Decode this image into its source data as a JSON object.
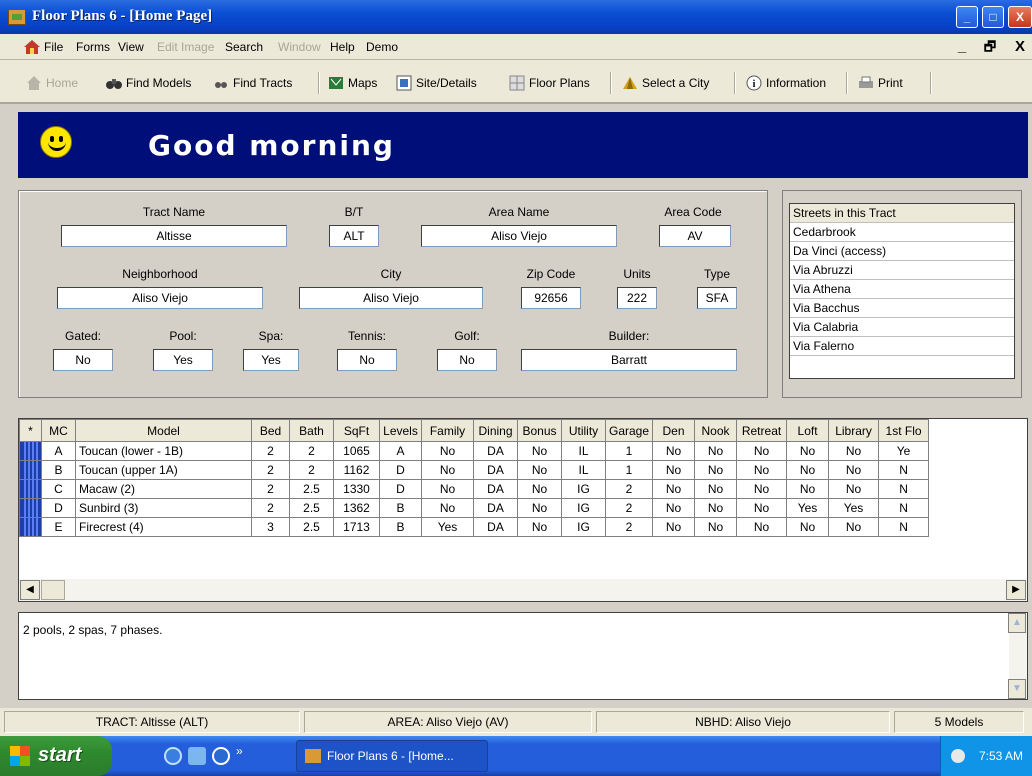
{
  "window": {
    "title": "Floor Plans 6 - [Home Page]",
    "min": "_",
    "max": "□",
    "close": "X"
  },
  "menu": {
    "items": [
      "File",
      "Forms",
      "View",
      "Edit Image",
      "Search",
      "Window",
      "Help",
      "Demo"
    ],
    "mdi_min": "_",
    "mdi_restore": "🗗",
    "mdi_close": "X"
  },
  "toolbar": {
    "items": [
      "Home",
      "Find Models",
      "Find Tracts",
      "Maps",
      "Site/Details",
      "Floor Plans",
      "Select a City",
      "Information",
      "Print"
    ]
  },
  "banner": {
    "greeting": "Good morning"
  },
  "tract": {
    "labels": {
      "tract_name": "Tract Name",
      "bt": "B/T",
      "area_name": "Area Name",
      "area_code": "Area Code",
      "neighborhood": "Neighborhood",
      "city": "City",
      "zip": "Zip Code",
      "units": "Units",
      "type": "Type",
      "gated": "Gated:",
      "pool": "Pool:",
      "spa": "Spa:",
      "tennis": "Tennis:",
      "golf": "Golf:",
      "builder": "Builder:"
    },
    "values": {
      "tract_name": "Altisse",
      "bt": "ALT",
      "area_name": "Aliso Viejo",
      "area_code": "AV",
      "neighborhood": "Aliso Viejo",
      "city": "Aliso Viejo",
      "zip": "92656",
      "units": "222",
      "type": "SFA",
      "gated": "No",
      "pool": "Yes",
      "spa": "Yes",
      "tennis": "No",
      "golf": "No",
      "builder": "Barratt"
    }
  },
  "streets": {
    "header": "Streets in this Tract",
    "items": [
      "Cedarbrook",
      "Da Vinci (access)",
      "Via Abruzzi",
      "Via Athena",
      "Via Bacchus",
      "Via Calabria",
      "Via Falerno"
    ]
  },
  "grid": {
    "columns": [
      "*",
      "MC",
      "Model",
      "Bed",
      "Bath",
      "SqFt",
      "Levels",
      "Family",
      "Dining",
      "Bonus",
      "Utility",
      "Garage",
      "Den",
      "Nook",
      "Retreat",
      "Loft",
      "Library",
      "1st Flo"
    ],
    "rows": [
      [
        "A",
        "Toucan (lower - 1B)",
        "2",
        "2",
        "1065",
        "A",
        "No",
        "DA",
        "No",
        "IL",
        "1",
        "No",
        "No",
        "No",
        "No",
        "No",
        "Ye"
      ],
      [
        "B",
        "Toucan (upper 1A)",
        "2",
        "2",
        "1162",
        "D",
        "No",
        "DA",
        "No",
        "IL",
        "1",
        "No",
        "No",
        "No",
        "No",
        "No",
        "N"
      ],
      [
        "C",
        "Macaw (2)",
        "2",
        "2.5",
        "1330",
        "D",
        "No",
        "DA",
        "No",
        "IG",
        "2",
        "No",
        "No",
        "No",
        "No",
        "No",
        "N"
      ],
      [
        "D",
        "Sunbird (3)",
        "2",
        "2.5",
        "1362",
        "B",
        "No",
        "DA",
        "No",
        "IG",
        "2",
        "No",
        "No",
        "No",
        "Yes",
        "Yes",
        "N"
      ],
      [
        "E",
        "Firecrest (4)",
        "3",
        "2.5",
        "1713",
        "B",
        "Yes",
        "DA",
        "No",
        "IG",
        "2",
        "No",
        "No",
        "No",
        "No",
        "No",
        "N"
      ]
    ]
  },
  "notes": {
    "text": "2 pools, 2 spas, 7 phases."
  },
  "status": {
    "tract": "TRACT:  Altisse (ALT)",
    "area": "AREA:  Aliso Viejo (AV)",
    "nbhd": "NBHD:  Aliso Viejo",
    "models": "5 Models"
  },
  "taskbar": {
    "start": "start",
    "task": "Floor Plans 6 - [Home...",
    "clock": "7:53 AM"
  }
}
